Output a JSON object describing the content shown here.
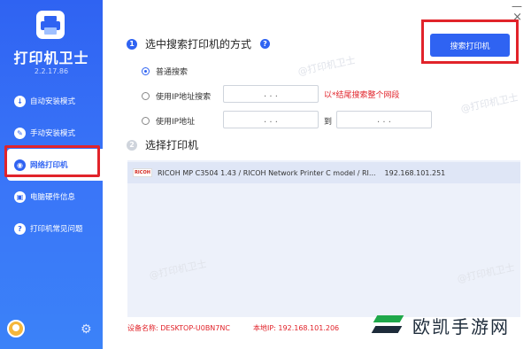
{
  "sidebar": {
    "app_title": "打印机卫士",
    "version": "2.2.17.86",
    "items": [
      {
        "label": "自动安装模式",
        "icon": "install-icon",
        "active": false
      },
      {
        "label": "手动安装模式",
        "icon": "wrench-icon",
        "active": false
      },
      {
        "label": "网络打印机",
        "icon": "network-icon",
        "active": true
      },
      {
        "label": "电脑硬件信息",
        "icon": "hardware-icon",
        "active": false
      },
      {
        "label": "打印机常见问题",
        "icon": "question-icon",
        "active": false
      }
    ],
    "settings_icon": "⚙"
  },
  "window": {
    "minimize": "—",
    "close": "×"
  },
  "section1": {
    "number": "1",
    "title": "选中搜索打印机的方式",
    "help": "?"
  },
  "search_button": "搜索打印机",
  "options": {
    "normal": "普通搜索",
    "ip_search": "使用IP地址搜索",
    "ip_hint": "以*结尾搜索整个网段",
    "ip_range": "使用IP地址",
    "to": "到",
    "ip_dots": ". . ."
  },
  "section2": {
    "number": "2",
    "title": "选择打印机"
  },
  "printers": [
    {
      "brand": "RICOH",
      "name": "RICOH MP C3504 1.43 / RICOH Network Printer C model / RI...",
      "ip": "192.168.101.251"
    }
  ],
  "footer": {
    "device_label": "设备名称: DESKTOP-U0BN7NC",
    "local_ip_label": "本地IP: 192.168.101.206"
  },
  "watermark": "@打印机卫士",
  "brand": {
    "text": "欧凯手游网"
  },
  "colors": {
    "accent": "#2f63f2",
    "highlight_red": "#e1232a",
    "list_bg": "#edf1fa"
  }
}
